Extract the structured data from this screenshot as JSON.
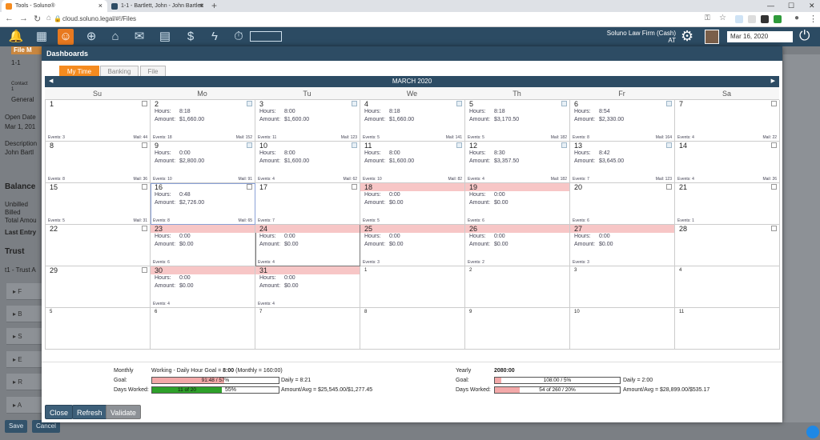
{
  "browser": {
    "tabs": [
      {
        "title": "Tools - Soluno®",
        "active": true
      },
      {
        "title": "1-1 - Bartlett, John - John Bartlett",
        "active": false
      }
    ],
    "url": "cloud.soluno.legal/#!/Files"
  },
  "app": {
    "firm_line1": "Soluno Law Firm (Cash)",
    "firm_line2": "AT",
    "date": "Mar 16, 2020"
  },
  "background": {
    "tab": "File M",
    "file_no": "1-1",
    "contact_label": "Contact",
    "contact_val": "1",
    "general_tab": "General",
    "open_date_label": "Open Date",
    "open_date": "Mar 1, 201",
    "description_label": "Description",
    "description": "John Bartl",
    "balance": "Balance",
    "unbilled": "Unbilled",
    "billed": "Billed",
    "total": "Total Amou",
    "last_entry": "Last Entry",
    "trust": "Trust",
    "trust_acct": "t1 - Trust A",
    "rows": [
      "F",
      "B",
      "S",
      "E",
      "R",
      "A"
    ],
    "save": "Save",
    "cancel": "Cancel"
  },
  "modal": {
    "title": "Dashboards",
    "tabs": [
      "My Time",
      "Banking",
      "File"
    ],
    "month": "MARCH 2020",
    "days": [
      "Su",
      "Mo",
      "Tu",
      "We",
      "Th",
      "Fr",
      "Sa"
    ],
    "hours_label": "Hours:",
    "amount_label": "Amount:",
    "events_label": "Events:",
    "mail_label": "Mail:",
    "cells": [
      {
        "d": "1",
        "cb": "plain",
        "events": "3",
        "mail": "44"
      },
      {
        "d": "2",
        "cb": "checked",
        "hours": "8:18",
        "amount": "$1,660.00",
        "events": "18",
        "mail": "152"
      },
      {
        "d": "3",
        "cb": "checked",
        "hours": "8:00",
        "amount": "$1,600.00",
        "events": "11",
        "mail": "123"
      },
      {
        "d": "4",
        "cb": "checked",
        "hours": "8:18",
        "amount": "$1,660.00",
        "events": "5",
        "mail": "141"
      },
      {
        "d": "5",
        "cb": "checked",
        "hours": "8:18",
        "amount": "$3,170.50",
        "events": "5",
        "mail": "182"
      },
      {
        "d": "6",
        "cb": "checked",
        "hours": "8:54",
        "amount": "$2,330.00",
        "events": "8",
        "mail": "164"
      },
      {
        "d": "7",
        "cb": "plain",
        "events": "4",
        "mail": "22"
      },
      {
        "d": "8",
        "cb": "plain",
        "events": "8",
        "mail": "36"
      },
      {
        "d": "9",
        "cb": "checked",
        "hours": "0:00",
        "amount": "$2,800.00",
        "events": "10",
        "mail": "91"
      },
      {
        "d": "10",
        "cb": "checked",
        "hours": "8:00",
        "amount": "$1,600.00",
        "events": "4",
        "mail": "62"
      },
      {
        "d": "11",
        "cb": "checked",
        "hours": "8:00",
        "amount": "$1,600.00",
        "events": "10",
        "mail": "82"
      },
      {
        "d": "12",
        "cb": "checked",
        "hours": "8:30",
        "amount": "$3,357.50",
        "events": "4",
        "mail": "182"
      },
      {
        "d": "13",
        "cb": "checked",
        "hours": "8:42",
        "amount": "$3,645.00",
        "events": "7",
        "mail": "123"
      },
      {
        "d": "14",
        "cb": "plain",
        "events": "4",
        "mail": "26"
      },
      {
        "d": "15",
        "cb": "plain",
        "events": "5",
        "mail": "31"
      },
      {
        "d": "16",
        "cb": "plain",
        "hours": "0:48",
        "amount": "$2,726.00",
        "events": "8",
        "mail": "65",
        "today": true
      },
      {
        "d": "17",
        "cb": "plain",
        "events": "7"
      },
      {
        "d": "18",
        "pink": true,
        "hours": "0:00",
        "amount": "$0.00",
        "events": "5"
      },
      {
        "d": "19",
        "pink": true,
        "hours": "0:00",
        "amount": "$0.00",
        "events": "6"
      },
      {
        "d": "20",
        "cb": "plain",
        "events": "6"
      },
      {
        "d": "21",
        "cb": "plain",
        "events": "1"
      },
      {
        "d": "22",
        "cb": "plain"
      },
      {
        "d": "23",
        "pink": true,
        "hours": "0:00",
        "amount": "$0.00",
        "events": "6"
      },
      {
        "d": "24",
        "pink": true,
        "hours": "0:00",
        "amount": "$0.00",
        "events": "4",
        "sel": true
      },
      {
        "d": "25",
        "pink": true,
        "hours": "0:00",
        "amount": "$0.00",
        "events": "3"
      },
      {
        "d": "26",
        "pink": true,
        "hours": "0:00",
        "amount": "$0.00",
        "events": "2"
      },
      {
        "d": "27",
        "pink": true,
        "hours": "0:00",
        "amount": "$0.00",
        "events": "3"
      },
      {
        "d": "28",
        "cb": "plain"
      },
      {
        "d": "29",
        "cb": "plain"
      },
      {
        "d": "30",
        "pink": true,
        "hours": "0:00",
        "amount": "$0.00",
        "events": "4"
      },
      {
        "d": "31",
        "pink": true,
        "hours": "0:00",
        "amount": "$0.00",
        "events": "4"
      },
      {
        "d": "1",
        "small": true
      },
      {
        "d": "2",
        "small": true
      },
      {
        "d": "3",
        "small": true
      },
      {
        "d": "4",
        "small": true
      },
      {
        "d": "5",
        "small": true
      },
      {
        "d": "6",
        "small": true
      },
      {
        "d": "7",
        "small": true
      },
      {
        "d": "8",
        "small": true
      },
      {
        "d": "9",
        "small": true
      },
      {
        "d": "10",
        "small": true
      },
      {
        "d": "11",
        "small": true
      }
    ],
    "monthly": {
      "label": "Monthly",
      "working": "Working - Daily Hour Goal = ",
      "daily_goal_value": "8:00",
      "monthly_goal": " (Monthly = 160:00)",
      "goal_label": "Goal:",
      "goal_text": "91:48 / 57%",
      "goal_pct": 57,
      "daily": "Daily = 8:21",
      "days_label": "Days Worked:",
      "days_text": "11 of 20",
      "days_pct": 55,
      "days_pct_text": "55%",
      "amount_avg": "Amount/Avg = $25,545.00/$1,277.45"
    },
    "yearly": {
      "label": "Yearly",
      "hours_goal": "2080:00",
      "goal_label": "Goal:",
      "goal_text": "108:00 / 5%",
      "goal_pct": 5,
      "daily": "Daily = 2:00",
      "days_label": "Days Worked:",
      "days_text": "54 of 260 / 20%",
      "days_pct": 20,
      "amount_avg": "Amount/Avg = $28,899.00/$535.17"
    },
    "buttons": [
      "Close",
      "Refresh",
      "Validate"
    ]
  }
}
